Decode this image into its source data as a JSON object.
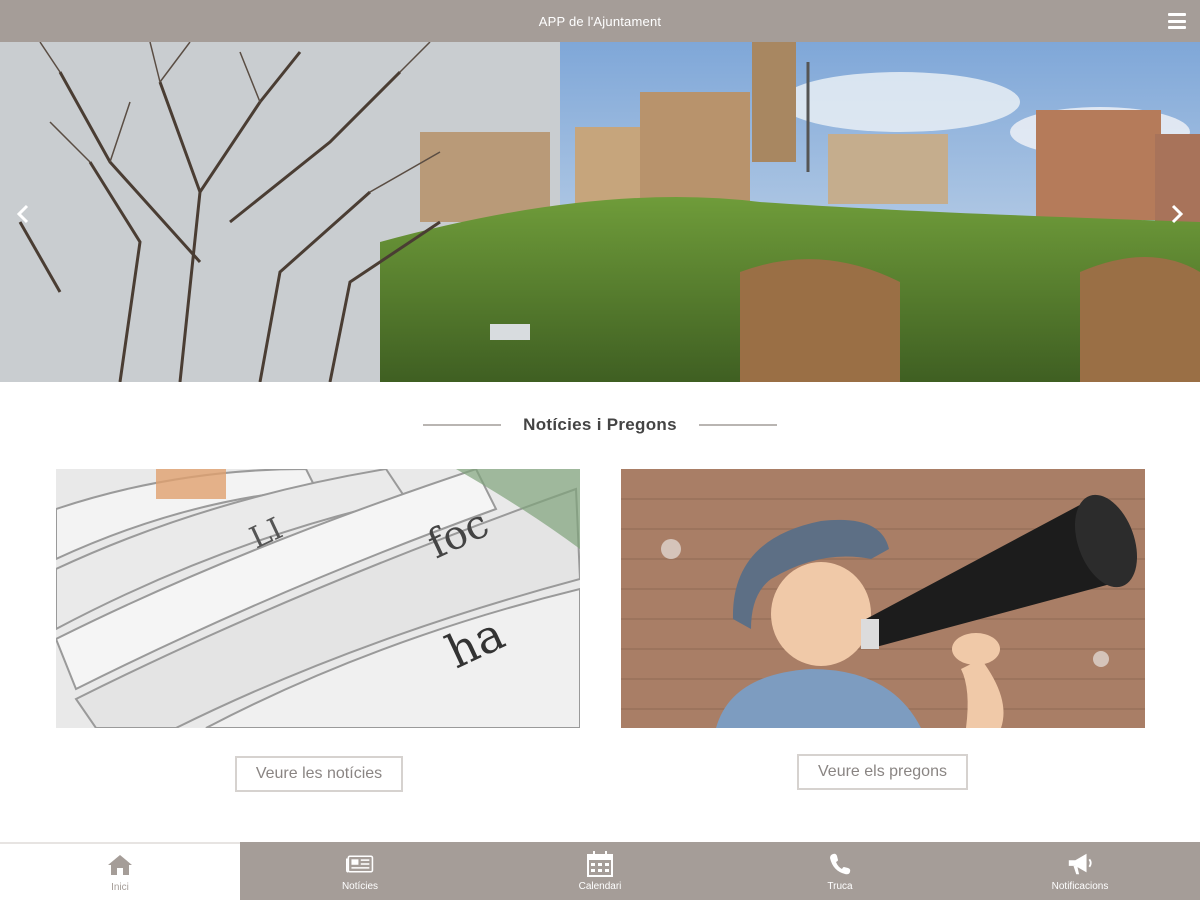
{
  "header": {
    "title": "APP de l'Ajuntament",
    "menu_icon": "hamburger-menu-icon"
  },
  "slider": {
    "image_subject": "town-landscape-photo",
    "prev_icon": "chevron-left-icon",
    "next_icon": "chevron-right-icon"
  },
  "section": {
    "title": "Notícies i Pregons"
  },
  "cards": [
    {
      "image_subject": "newspapers-photo",
      "button_label": "Veure les notícies"
    },
    {
      "image_subject": "child-megaphone-photo",
      "button_label": "Veure els pregons"
    }
  ],
  "bottom_nav": [
    {
      "label": "Inici",
      "icon": "home-icon",
      "active": true
    },
    {
      "label": "Notícies",
      "icon": "newspaper-icon",
      "active": false
    },
    {
      "label": "Calendari",
      "icon": "calendar-icon",
      "active": false
    },
    {
      "label": "Truca",
      "icon": "phone-icon",
      "active": false
    },
    {
      "label": "Notificacions",
      "icon": "megaphone-icon",
      "active": false
    }
  ],
  "colors": {
    "bar": "#a59d98",
    "bar_text": "#ffffff",
    "button_border": "#d6d2cf",
    "button_text": "#8a8583"
  }
}
